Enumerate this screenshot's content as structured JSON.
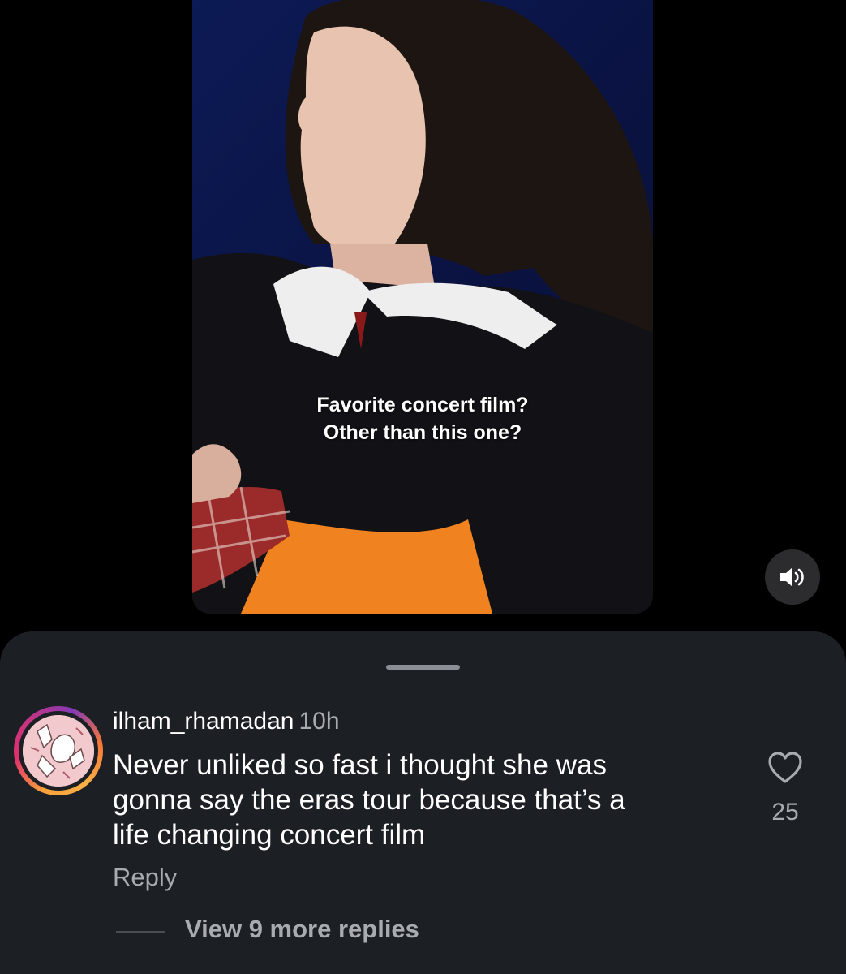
{
  "video": {
    "caption_line1": "Favorite concert film?",
    "caption_line2": "Other than this one?",
    "sound_icon": "speaker-volume-icon"
  },
  "comment": {
    "username": "ilham_rhamadan",
    "timestamp": "10h",
    "text_lines": [
      "Never unliked so fast i thought she was",
      "gonna say the eras tour because that’s a",
      "life changing concert film"
    ],
    "like_count": "25",
    "like_icon": "heart-outline-icon",
    "reply_label": "Reply",
    "view_replies_label": "View 9 more replies"
  },
  "colors": {
    "background": "#000000",
    "sheet": "#1c1f24",
    "secondary_text": "#a8abb0",
    "primary_text": "#ffffff"
  }
}
